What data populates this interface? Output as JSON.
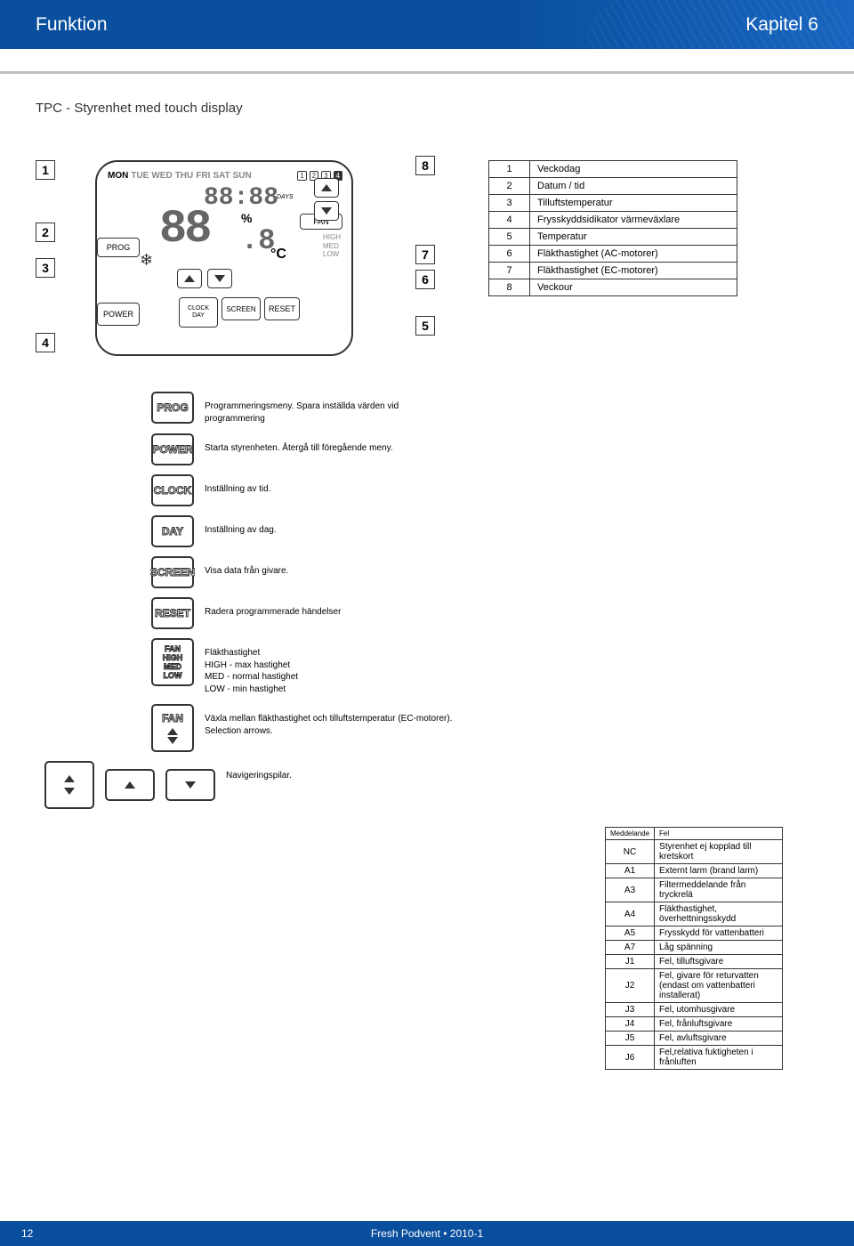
{
  "header": {
    "left": "Funktion",
    "right": "Kapitel 6"
  },
  "section_title": "TPC - Styrenhet med touch display",
  "lcd": {
    "days": [
      "MON",
      "TUE",
      "WED",
      "THU",
      "FRI",
      "SAT",
      "SUN"
    ],
    "day_nums": [
      "1",
      "2",
      "3",
      "4"
    ],
    "time_digits": "88:88",
    "days_text": "DAYS",
    "big_digits": "88",
    "small_digit": ".8",
    "pct": "%",
    "degc": "°C",
    "fan": "FAN",
    "high": "HIGH",
    "med": "MED",
    "low": "LOW",
    "prog": "PROG",
    "power": "POWER",
    "clock": "CLOCK",
    "day": "DAY",
    "screen": "SCREEN",
    "reset": "RESET"
  },
  "callouts_left": [
    "1",
    "2",
    "3",
    "4"
  ],
  "callouts_right": [
    "8",
    "7",
    "6",
    "5"
  ],
  "legend": [
    {
      "n": "1",
      "t": "Veckodag"
    },
    {
      "n": "2",
      "t": "Datum / tid"
    },
    {
      "n": "3",
      "t": "Tilluftstemperatur"
    },
    {
      "n": "4",
      "t": "Frysskyddsidikator värmeväxlare"
    },
    {
      "n": "5",
      "t": "Temperatur"
    },
    {
      "n": "6",
      "t": "Fläkthastighet (AC-motorer)"
    },
    {
      "n": "7",
      "t": "Fläkthastighet (EC-motorer)"
    },
    {
      "n": "8",
      "t": "Veckour"
    }
  ],
  "buttons": [
    {
      "label": "PROG",
      "desc": "Programmeringsmeny. Spara inställda värden vid programmering"
    },
    {
      "label": "POWER",
      "desc": "Starta styrenheten. Återgå till föregående meny."
    },
    {
      "label": "CLOCK",
      "desc": "Inställning av tid."
    },
    {
      "label": "DAY",
      "desc": "Inställning av dag."
    },
    {
      "label": "SCREEN",
      "desc": "Visa data från givare."
    },
    {
      "label": "RESET",
      "desc": "Radera programmerade händelser"
    },
    {
      "label": "FAN_LEVELS",
      "desc": "Fläkthastighet\nHIGH - max hastighet\nMED - normal hastighet\nLOW - min hastighet"
    },
    {
      "label": "FAN_ARROWS",
      "desc": "Växla mellan fläkthastighet och tilluftstemperatur (EC-motorer). Selection arrows."
    },
    {
      "label": "NAV",
      "desc": "Navigeringspilar."
    }
  ],
  "errors": {
    "head": {
      "c": "Meddelande",
      "t": "Fel"
    },
    "rows": [
      {
        "c": "NC",
        "t": "Styrenhet ej kopplad till kretskort"
      },
      {
        "c": "A1",
        "t": "Externt larm (brand larm)"
      },
      {
        "c": "A3",
        "t": "Filtermeddelande från tryckrelä"
      },
      {
        "c": "A4",
        "t": "Fläkthastighet, överhettningsskydd"
      },
      {
        "c": "A5",
        "t": "Frysskydd för vattenbatteri"
      },
      {
        "c": "A7",
        "t": "Låg spänning"
      },
      {
        "c": "J1",
        "t": "Fel, tilluftsgivare"
      },
      {
        "c": "J2",
        "t": "Fel, givare för returvatten (endast om vattenbatteri installerat)"
      },
      {
        "c": "J3",
        "t": "Fel, utomhusgivare"
      },
      {
        "c": "J4",
        "t": "Fel, frånluftsgivare"
      },
      {
        "c": "J5",
        "t": "Fel, avluftsgivare"
      },
      {
        "c": "J6",
        "t": "Fel,relativa fuktigheten i frånluften"
      }
    ]
  },
  "footer": {
    "page": "12",
    "center": "Fresh Podvent • 2010-1"
  }
}
